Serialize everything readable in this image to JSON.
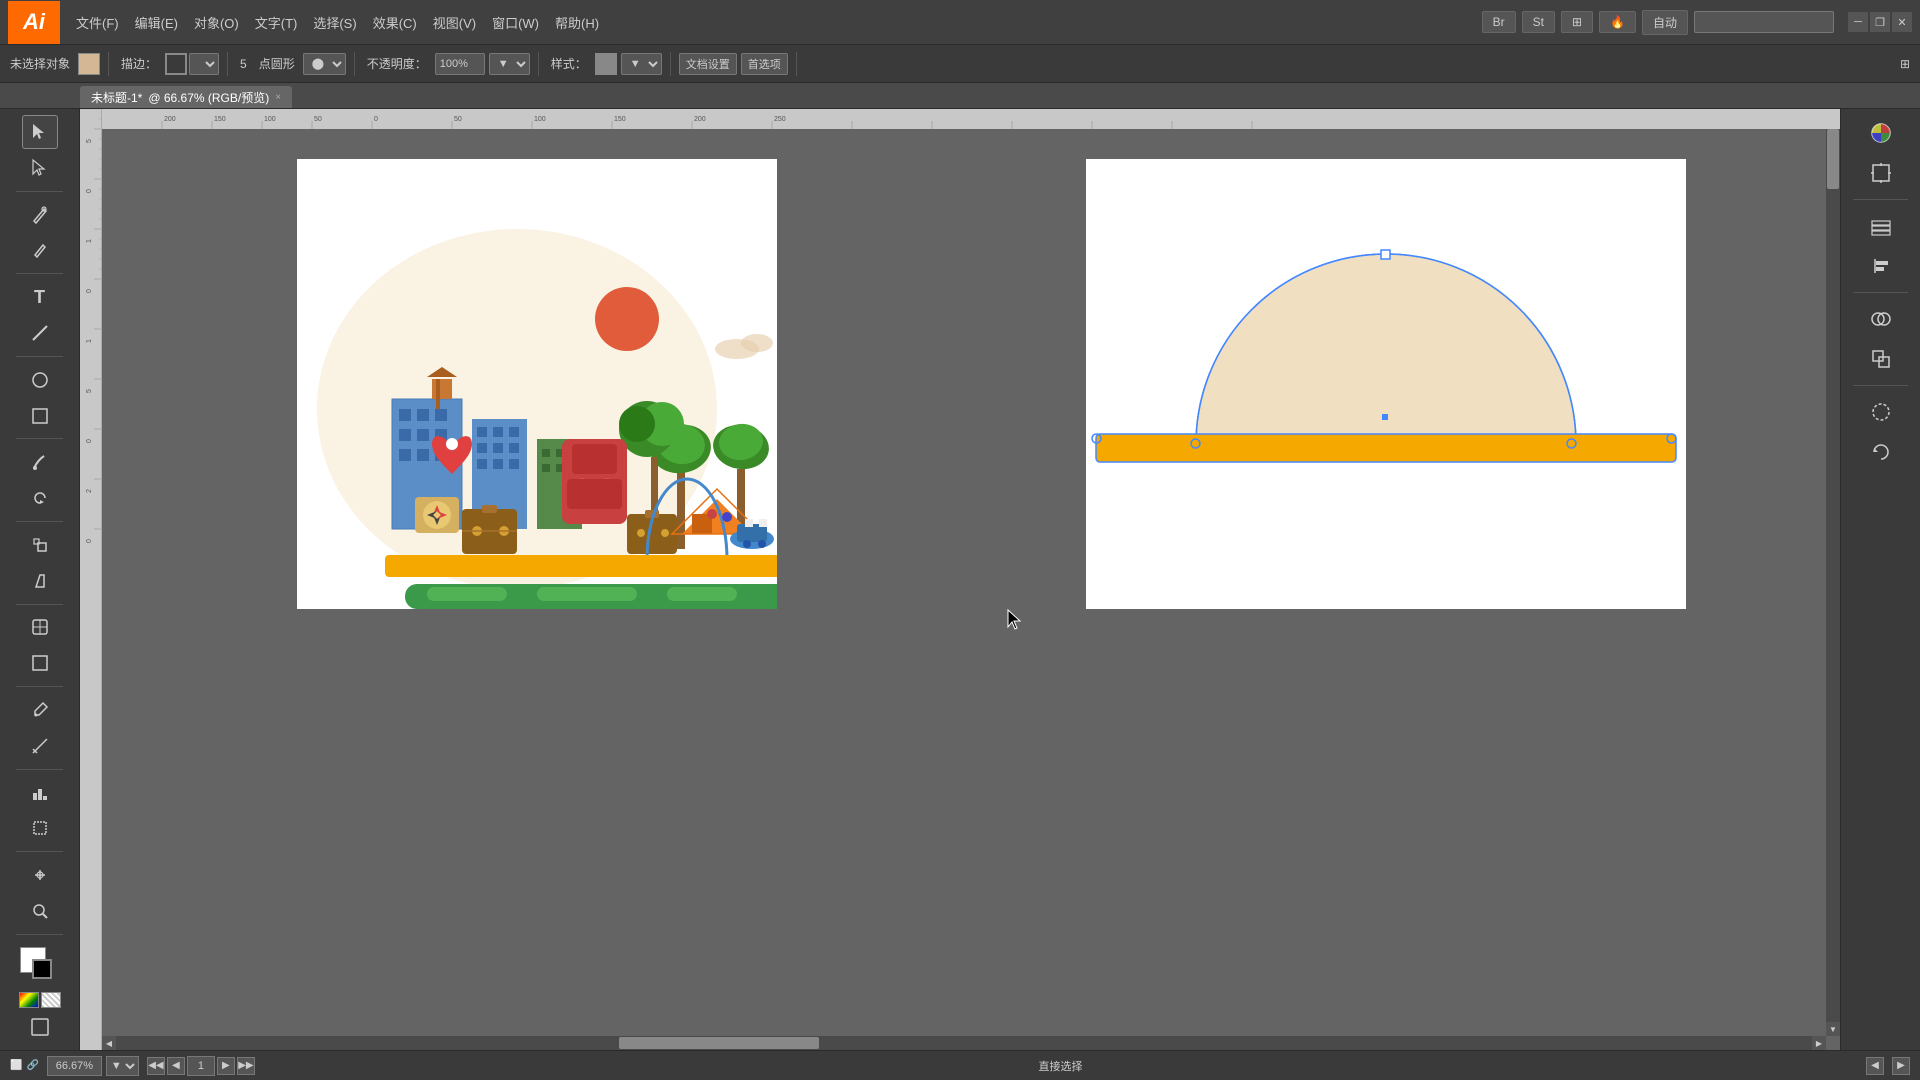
{
  "app": {
    "logo": "Ai",
    "logo_bg": "#FF6A00"
  },
  "menu": {
    "items": [
      "文件(F)",
      "编辑(E)",
      "对象(O)",
      "文字(T)",
      "选择(S)",
      "效果(C)",
      "视图(V)",
      "窗口(W)",
      "帮助(H)"
    ]
  },
  "menu_right": {
    "btn1": "Br",
    "btn2": "St",
    "btn3": "自动",
    "search_placeholder": ""
  },
  "toolbar": {
    "label1": "未选择对象",
    "color_label": "描边：",
    "stroke_label": "5",
    "shape_label": "点圆形",
    "opacity_label": "不透明度：",
    "opacity_value": "100%",
    "style_label": "样式：",
    "doc_settings": "文档设置",
    "preferences": "首选项"
  },
  "tab": {
    "title": "未标题-1*",
    "info": "@ 66.67% (RGB/预览)",
    "close": "×"
  },
  "status": {
    "zoom": "66.67%",
    "page": "1",
    "mode": "直接选择"
  },
  "canvas": {
    "bg": "#646464"
  },
  "artboard2": {
    "semicircle_fill": "#f0dfc0",
    "bar_fill": "#F5A800",
    "bar_stroke": "#E09000"
  },
  "right_panel": {
    "icons": [
      "color-wheel",
      "artboard",
      "grid",
      "grid2",
      "fill",
      "stroke",
      "blur",
      "reset"
    ]
  }
}
